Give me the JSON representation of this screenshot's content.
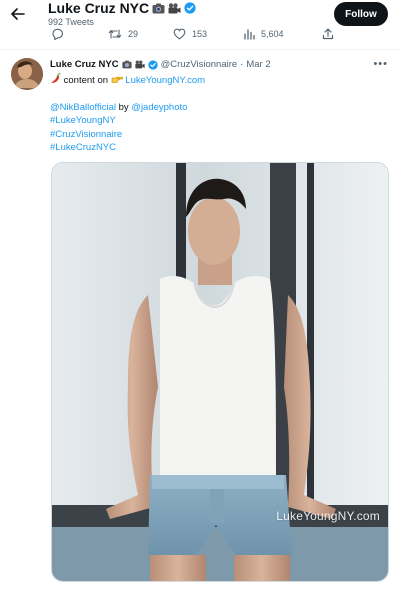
{
  "header": {
    "profile_name": "Luke Cruz NYC",
    "tweet_count": "992 Tweets",
    "follow_label": "Follow"
  },
  "previous_tweet_actions": {
    "retweets": "29",
    "likes": "153",
    "views": "5,604"
  },
  "tweet": {
    "author_name": "Luke Cruz NYC",
    "handle": "@CruzVisionnaire",
    "separator": "·",
    "date": "Mar 2",
    "line1_text": "content on",
    "line1_link": "LukeYoungNY.com",
    "mention1": "@NikBallofficial",
    "by_text": "by",
    "mention2": "@jadeyphoto",
    "hashtags": [
      "#LukeYoungNY",
      "#CruzVisionnaire",
      "#LukeCruzNYC"
    ],
    "media_watermark": "LukeYoungNY.com"
  },
  "colors": {
    "accent": "#1d9bf0",
    "text": "#0f1419",
    "muted": "#536471",
    "follow_bg": "#0f1419"
  }
}
